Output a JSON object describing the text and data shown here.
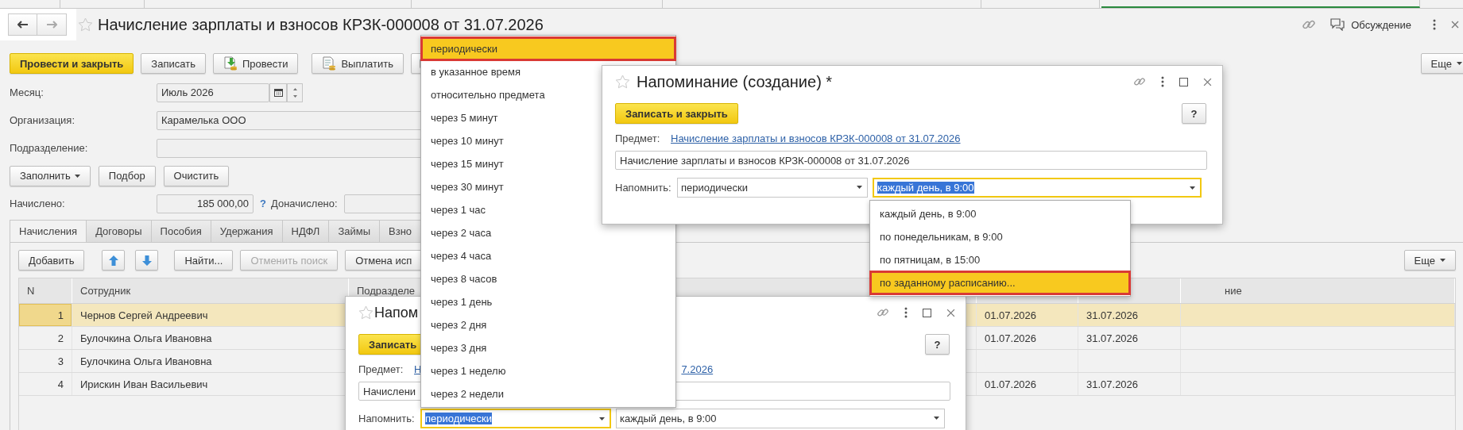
{
  "document": {
    "title": "Начисление зарплаты и взносов КРЗК-000008 от 31.07.2026",
    "discussion_label": "Обсуждение"
  },
  "toolbar": {
    "buttons": [
      {
        "kind": "primary",
        "label": "Провести и закрыть"
      },
      {
        "kind": "plain",
        "label": "Записать"
      },
      {
        "kind": "post",
        "label": "Провести"
      },
      {
        "kind": "pay",
        "label": "Выплатить"
      },
      {
        "kind": "attach"
      }
    ],
    "more": "Еще"
  },
  "fields": [
    {
      "kind": "period",
      "label": "Месяц:",
      "value": "Июль 2026"
    },
    {
      "kind": "text",
      "label": "Организация:",
      "value": "Карамелька ООО"
    },
    {
      "kind": "text",
      "label": "Подразделение:"
    }
  ],
  "fill_buttons": [
    {
      "kind": "menu",
      "label": "Заполнить"
    },
    {
      "kind": "plain",
      "label": "Подбор"
    },
    {
      "kind": "plain",
      "label": "Очистить"
    }
  ],
  "totals": {
    "accrued_label": "Начислено:",
    "accrued_value": "185 000,00",
    "help": "?",
    "extra_label": "Доначислено:"
  },
  "tabs": [
    {
      "label": "Начисления",
      "selected": true
    },
    {
      "label": "Договоры",
      "selected": false
    },
    {
      "label": "Пособия",
      "selected": false
    },
    {
      "label": "Удержания",
      "selected": false
    },
    {
      "label": "НДФЛ",
      "selected": false
    },
    {
      "label": "Займы",
      "selected": false
    },
    {
      "label": "Взно",
      "selected": false
    }
  ],
  "table_toolbar": {
    "buttons": [
      {
        "kind": "plain",
        "label": "Добавить",
        "disabled": false
      },
      {
        "kind": "arrows"
      },
      {
        "kind": "plain",
        "label": "Найти...",
        "disabled": false
      },
      {
        "kind": "plain",
        "label": "Отменить поиск",
        "disabled": true
      },
      {
        "kind": "plain",
        "label": "Отмена исп",
        "disabled": false
      }
    ],
    "more": "Еще"
  },
  "table": {
    "columns": [
      "N",
      "Сотрудник",
      "Подразделе",
      "ние"
    ],
    "rows": [
      {
        "n": "1",
        "employee": "Чернов Сергей Андреевич",
        "column_5": "01.07.2026",
        "column_6": "31.07.2026",
        "selected": true
      },
      {
        "n": "2",
        "employee": "Булочкина Ольга Ивановна",
        "column_5": "01.07.2026",
        "column_6": "31.07.2026",
        "selected": false
      },
      {
        "n": "3",
        "employee": "Булочкина Ольга Ивановна",
        "selected": false
      },
      {
        "n": "4",
        "employee": "Ирискин Иван Васильевич",
        "column_5": "01.07.2026",
        "column_6": "31.07.2026",
        "selected": false
      }
    ]
  },
  "choice_list": {
    "items": [
      {
        "label": "периодически",
        "selected": true
      },
      {
        "label": "в указанное время",
        "selected": false
      },
      {
        "label": "относительно предмета",
        "selected": false
      },
      {
        "label": "через 5 минут",
        "selected": false
      },
      {
        "label": "через 10 минут",
        "selected": false
      },
      {
        "label": "через 15 минут",
        "selected": false
      },
      {
        "label": "через 30 минут",
        "selected": false
      },
      {
        "label": "через 1 час",
        "selected": false
      },
      {
        "label": "через 2 часа",
        "selected": false
      },
      {
        "label": "через 4 часа",
        "selected": false
      },
      {
        "label": "через 8 часов",
        "selected": false
      },
      {
        "label": "через 1 день",
        "selected": false
      },
      {
        "label": "через 2 дня",
        "selected": false
      },
      {
        "label": "через 3 дня",
        "selected": false
      },
      {
        "label": "через 1 неделю",
        "selected": false
      },
      {
        "label": "через 2 недели",
        "selected": false
      }
    ]
  },
  "reminder_dialogs": [
    {
      "title": "Напоминание (создание) *",
      "save_button": "Записать и закрыть",
      "help": "?",
      "subject_label": "Предмет:",
      "subject_link": [
        "Начисление зарплаты и взносов КРЗК-000008 от 31.07.2026"
      ],
      "description": "Начисление зарплаты и взносов КРЗК-000008 от 31.07.2026",
      "remind_label": "Напомнить:",
      "remind_mode": {
        "value": "периодически",
        "focused": false
      },
      "schedule": {
        "value": "каждый день, в 9:00",
        "focused": true
      }
    },
    {
      "title": "Напом",
      "save_button": "Записать",
      "help": "?",
      "subject_label": "Предмет:",
      "subject_link": [
        "Н",
        "7.2026"
      ],
      "description": "Начислени",
      "remind_label": "Напомнить:",
      "remind_mode": {
        "value": "периодически",
        "focused": true
      },
      "schedule": {
        "value": "каждый день, в 9:00",
        "focused": false
      }
    }
  ],
  "schedule_list": {
    "items": [
      {
        "label": "каждый день, в 9:00",
        "selected": false
      },
      {
        "label": "по понедельникам, в 9:00",
        "selected": false
      },
      {
        "label": "по пятницам, в 15:00",
        "selected": false
      },
      {
        "label": "по заданному расписанию...",
        "selected": true
      }
    ]
  }
}
